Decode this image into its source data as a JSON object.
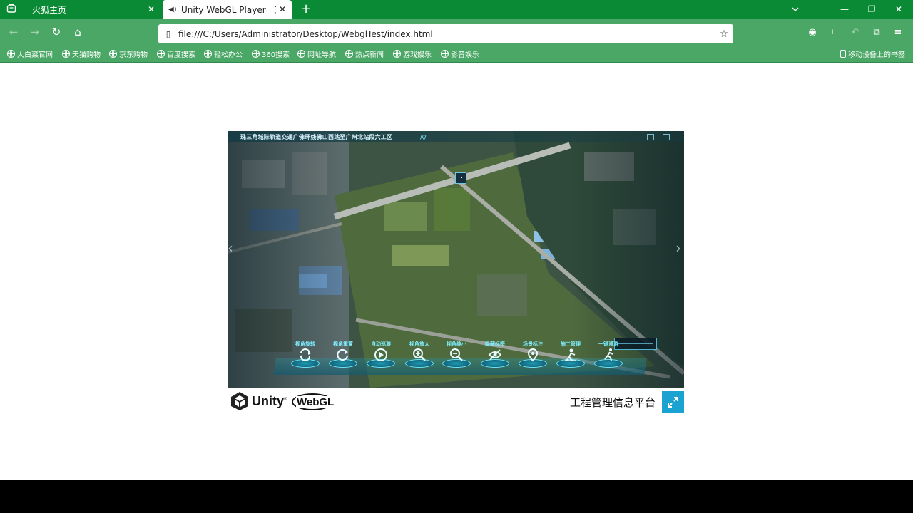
{
  "browser": {
    "tabs": [
      {
        "title": "火狐主页",
        "active": false
      },
      {
        "title": "Unity WebGL Player | 工程管理",
        "active": true
      }
    ],
    "address": "file:///C:/Users/Administrator/Desktop/WebglTest/index.html",
    "theme_color": "#0a8a35",
    "toolbar_color": "#4aa765",
    "bookmarks": [
      "大白菜官网",
      "天猫购物",
      "京东购物",
      "百度搜索",
      "轻松办公",
      "360搜索",
      "网址导航",
      "热点新闻",
      "游戏娱乐",
      "影音娱乐"
    ],
    "mobile_bookmarks": "移动设备上的书签"
  },
  "unity": {
    "scene_title": "珠三角城际轨道交通广佛环线佛山西站至广州北站段六工区",
    "tools": [
      {
        "label": "视角旋转",
        "icon": "rotate-icon"
      },
      {
        "label": "视角重置",
        "icon": "reset-icon"
      },
      {
        "label": "自动巡游",
        "icon": "play-icon"
      },
      {
        "label": "视角放大",
        "icon": "zoom-in-icon"
      },
      {
        "label": "视角缩小",
        "icon": "zoom-out-icon"
      },
      {
        "label": "隐藏标签",
        "icon": "hide-icon"
      },
      {
        "label": "场景标注",
        "icon": "location-icon"
      },
      {
        "label": "施工管理",
        "icon": "worker-icon"
      },
      {
        "label": "一键漫游",
        "icon": "walk-icon"
      }
    ],
    "accent_color": "#1aa3d1",
    "platform_title": "工程管理信息平台",
    "unity_brand": "Unity",
    "webgl_brand": "WebGL"
  }
}
